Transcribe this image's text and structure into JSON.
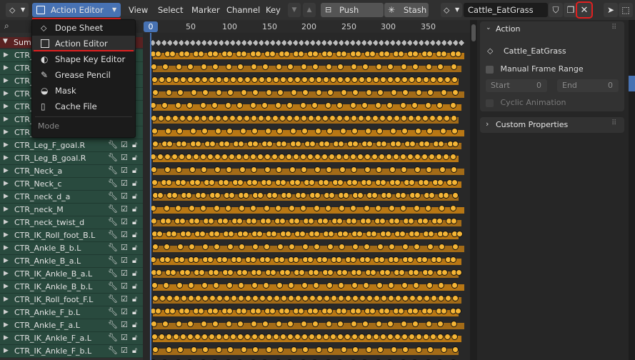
{
  "header": {
    "editor_type_icon": "dope-sheet-icon",
    "mode_dropdown": {
      "label": "Action Editor",
      "icon": "action-editor-icon"
    },
    "menus": [
      "View",
      "Select",
      "Marker",
      "Channel",
      "Key"
    ],
    "push_down_label": "Push Down",
    "stash_label": "Stash",
    "action_name": "Cattle_EatGrass"
  },
  "mode_menu": {
    "items": [
      {
        "label": "Dope Sheet",
        "icon": "dope-sheet-icon"
      },
      {
        "label": "Action Editor",
        "icon": "action-editor-icon"
      },
      {
        "label": "Shape Key Editor",
        "icon": "shape-key-icon"
      },
      {
        "label": "Grease Pencil",
        "icon": "grease-pencil-icon"
      },
      {
        "label": "Mask",
        "icon": "mask-icon"
      },
      {
        "label": "Cache File",
        "icon": "cache-file-icon"
      }
    ],
    "section_label": "Mode"
  },
  "timeline": {
    "current_frame": "0",
    "ticks": [
      "50",
      "100",
      "150",
      "200",
      "250",
      "300",
      "350"
    ]
  },
  "channels": {
    "summary_label": "Summary",
    "hidden_rows": [
      "CTR_",
      "CTR_",
      "CTR_",
      "CTR_",
      "CTR_",
      "CTR_",
      "CTR_",
      "CTR_"
    ],
    "rows": [
      "CTR_Leg_F_goal.R",
      "CTR_Leg_B_goal.R",
      "CTR_Neck_a",
      "CTR_Neck_c",
      "CTR_neck_d_a",
      "CTR_neck_M",
      "CTR_neck_twist_d",
      "CTR_IK_Roll_foot_B.L",
      "CTR_Ankle_B_b.L",
      "CTR_Ankle_B_a.L",
      "CTR_IK_Ankle_B_a.L",
      "CTR_IK_Ankle_B_b.L",
      "CTR_IK_Roll_foot_F.L",
      "CTR_Ankle_F_b.L",
      "CTR_Ankle_F_a.L",
      "CTR_IK_Ankle_F_a.L",
      "CTR_IK_Ankle_F_b.L"
    ]
  },
  "sidebar": {
    "action_panel_title": "Action",
    "action_name": "Cattle_EatGrass",
    "manual_frame_range_label": "Manual Frame Range",
    "start_label": "Start",
    "start_value": "0",
    "end_label": "End",
    "end_value": "0",
    "cyclic_label": "Cyclic Animation",
    "custom_properties_label": "Custom Properties"
  },
  "colors": {
    "accent": "#4772b3",
    "keyframe": "#f5b535",
    "hold_bar": "#b87714",
    "highlight": "#e02020"
  }
}
